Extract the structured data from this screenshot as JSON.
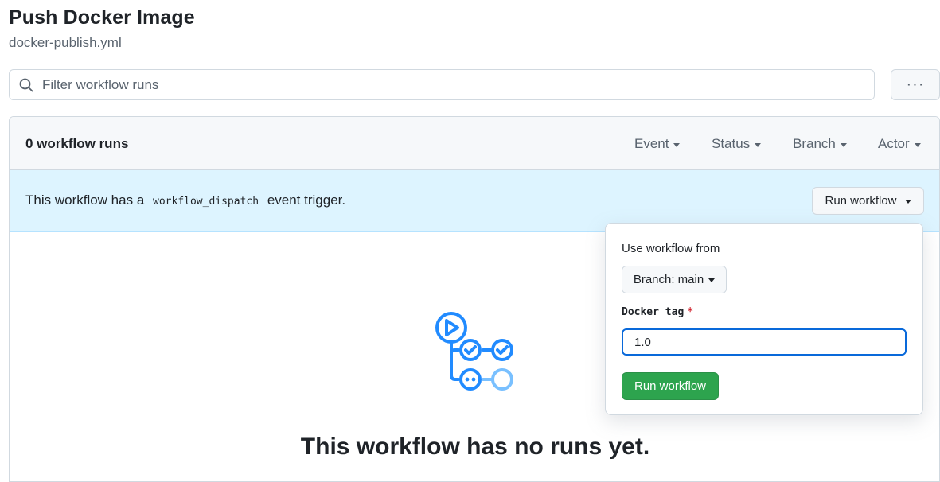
{
  "page": {
    "title": "Push Docker Image",
    "subtitle": "docker-publish.yml"
  },
  "filter": {
    "placeholder": "Filter workflow runs",
    "icon": "search-icon",
    "more_label": "···"
  },
  "runs": {
    "count_label": "0 workflow runs",
    "filters": [
      {
        "label": "Event"
      },
      {
        "label": "Status"
      },
      {
        "label": "Branch"
      },
      {
        "label": "Actor"
      }
    ]
  },
  "banner": {
    "text_before": "This workflow has a",
    "code": "workflow_dispatch",
    "text_after": "event trigger.",
    "run_button_label": "Run workflow"
  },
  "popover": {
    "use_from_label": "Use workflow from",
    "branch_button_label": "Branch: main",
    "input_label": "Docker tag",
    "required_mark": "*",
    "input_value": "1.0",
    "submit_label": "Run workflow"
  },
  "empty_state": {
    "title": "This workflow has no runs yet.",
    "icon": "workflow-icon"
  },
  "colors": {
    "accent": "#0969da",
    "banner_bg": "#ddf4ff",
    "primary_button": "#2da44e",
    "icon_blue": "#218bff",
    "required": "#d1242f"
  }
}
